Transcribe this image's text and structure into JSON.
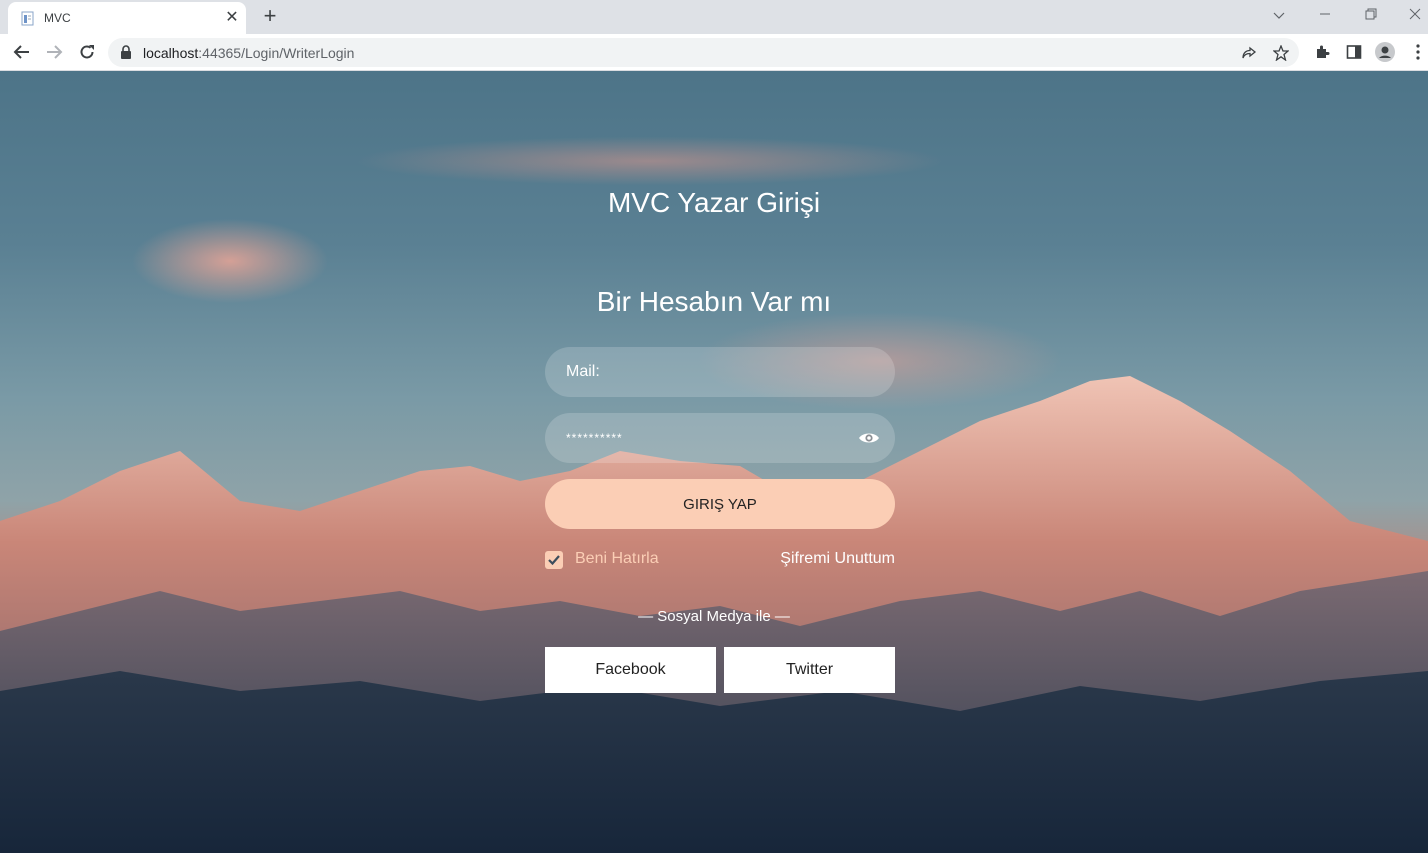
{
  "browser": {
    "tab_title": "MVC",
    "url_host": "localhost",
    "url_rest": ":44365/Login/WriterLogin"
  },
  "page": {
    "title": "MVC Yazar Girişi",
    "subtitle": "Bir Hesabın Var mı",
    "mail_placeholder": "Mail:",
    "password_value": "**********",
    "login_button": "GIRIŞ YAP",
    "remember_label": "Beni Hatırla",
    "remember_checked": true,
    "forgot_link": "Şifremi Unuttum",
    "social_label": "— Sosyal Medya ile —",
    "facebook_button": "Facebook",
    "twitter_button": "Twitter"
  },
  "icons": {
    "favicon": "document-icon",
    "lock": "lock-icon",
    "eye": "eye-icon"
  },
  "colors": {
    "accent": "#fbceb5"
  }
}
